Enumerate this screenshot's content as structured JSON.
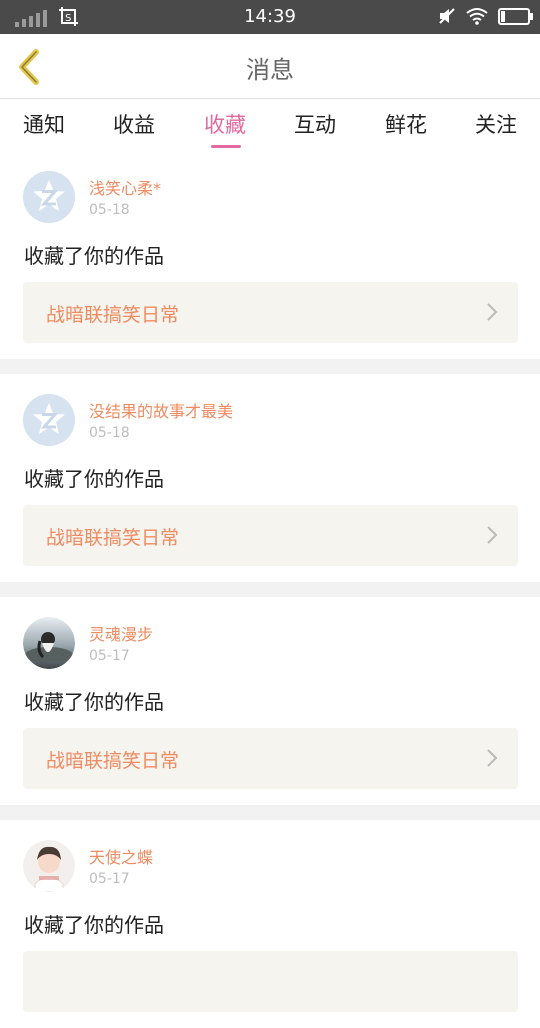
{
  "status": {
    "time": "14:39"
  },
  "header": {
    "title": "消息"
  },
  "tabs": [
    {
      "label": "通知"
    },
    {
      "label": "收益"
    },
    {
      "label": "收藏"
    },
    {
      "label": "互动"
    },
    {
      "label": "鲜花"
    },
    {
      "label": "关注"
    }
  ],
  "active_tab": "收藏",
  "colors": {
    "accent_pink": "#e26aa0",
    "name_orange": "#ef8b61",
    "card_bg": "#f5f4ee"
  },
  "items": [
    {
      "name": "浅笑心柔*",
      "date": "05-18",
      "action": "收藏了你的作品",
      "work": "战暗联搞笑日常",
      "avatar": "default-avatar-icon"
    },
    {
      "name": "没结果的故事才最美",
      "date": "05-18",
      "action": "收藏了你的作品",
      "work": "战暗联搞笑日常",
      "avatar": "default-avatar-icon"
    },
    {
      "name": "灵魂漫步",
      "date": "05-17",
      "action": "收藏了你的作品",
      "work": "战暗联搞笑日常",
      "avatar": "photo-avatar"
    },
    {
      "name": "天使之蝶",
      "date": "05-17",
      "action": "收藏了你的作品",
      "work": "",
      "avatar": "photo-avatar"
    }
  ]
}
